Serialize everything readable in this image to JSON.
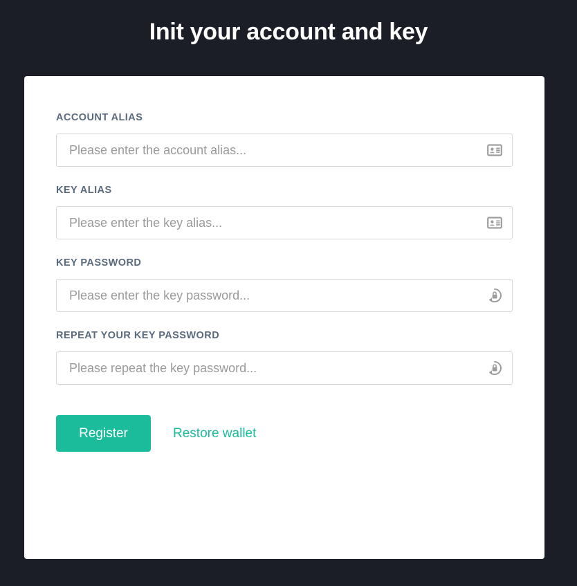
{
  "header": {
    "title": "Init your account and key"
  },
  "theme": {
    "background": "#1b1e27",
    "card_background": "#ffffff",
    "accent": "#1abc9c",
    "label_color": "#5a6a7e",
    "placeholder_color": "#9a9a9a"
  },
  "form": {
    "fields": [
      {
        "label": "ACCOUNT ALIAS",
        "placeholder": "Please enter the account alias...",
        "value": "",
        "icon": "id-card-icon"
      },
      {
        "label": "KEY ALIAS",
        "placeholder": "Please enter the key alias...",
        "value": "",
        "icon": "id-card-icon"
      },
      {
        "label": "KEY PASSWORD",
        "placeholder": "Please enter the key password...",
        "value": "",
        "icon": "lock-reset-icon"
      },
      {
        "label": "REPEAT YOUR KEY PASSWORD",
        "placeholder": "Please repeat the key password...",
        "value": "",
        "icon": "lock-reset-icon"
      }
    ],
    "submit_label": "Register",
    "restore_label": "Restore wallet"
  }
}
